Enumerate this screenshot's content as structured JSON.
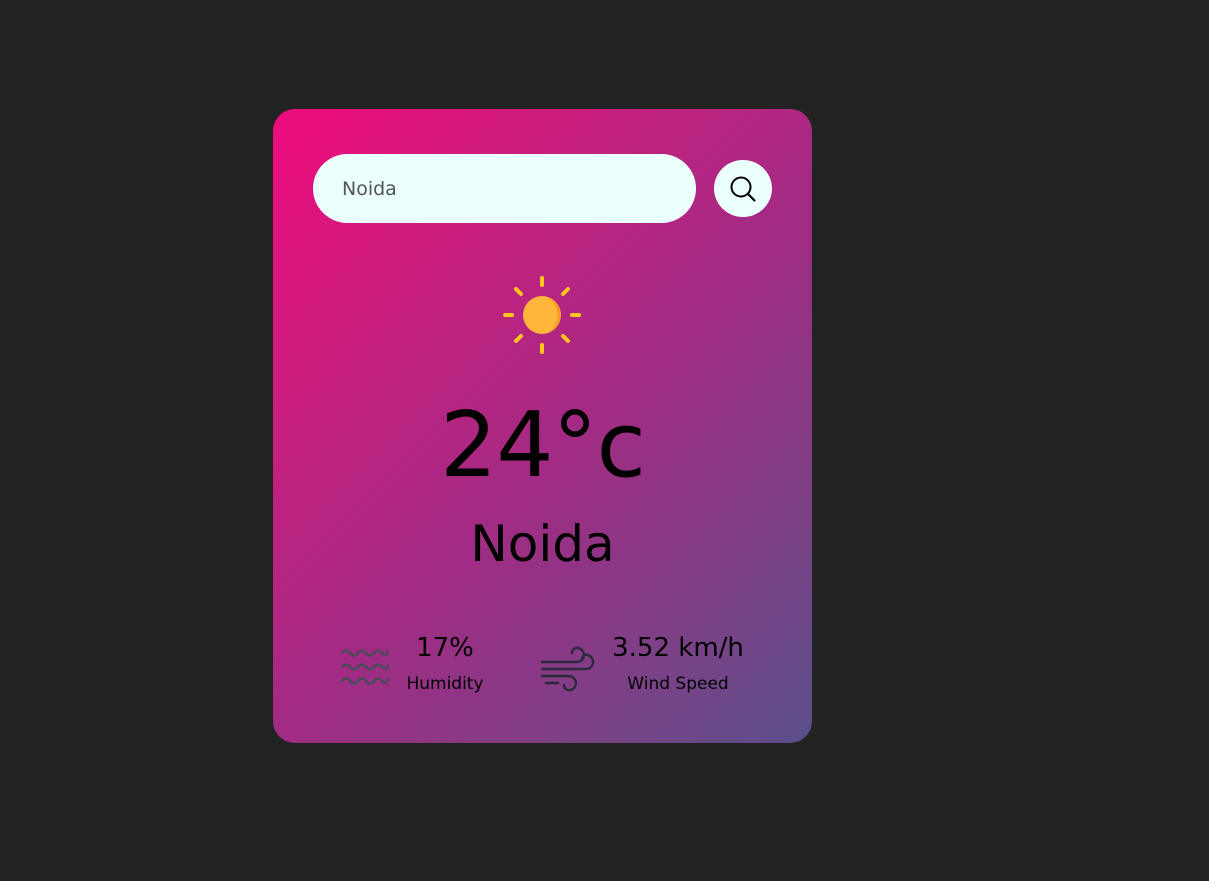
{
  "search": {
    "value": "Noida",
    "button_icon": "search-icon"
  },
  "weather": {
    "icon": "sun-icon",
    "temperature": "24°c",
    "city": "Noida"
  },
  "details": {
    "humidity": {
      "icon": "humidity-waves-icon",
      "value": "17%",
      "label": "Humidity"
    },
    "wind": {
      "icon": "wind-icon",
      "value": "3.52 km/h",
      "label": "Wind Speed"
    }
  },
  "colors": {
    "background": "#222222",
    "card_gradient_start": "#f00b7c",
    "card_gradient_end": "#5a4f8a",
    "input_background": "#ebfffc",
    "sun": "#ffb63b",
    "sun_rays": "#ffc61b"
  }
}
